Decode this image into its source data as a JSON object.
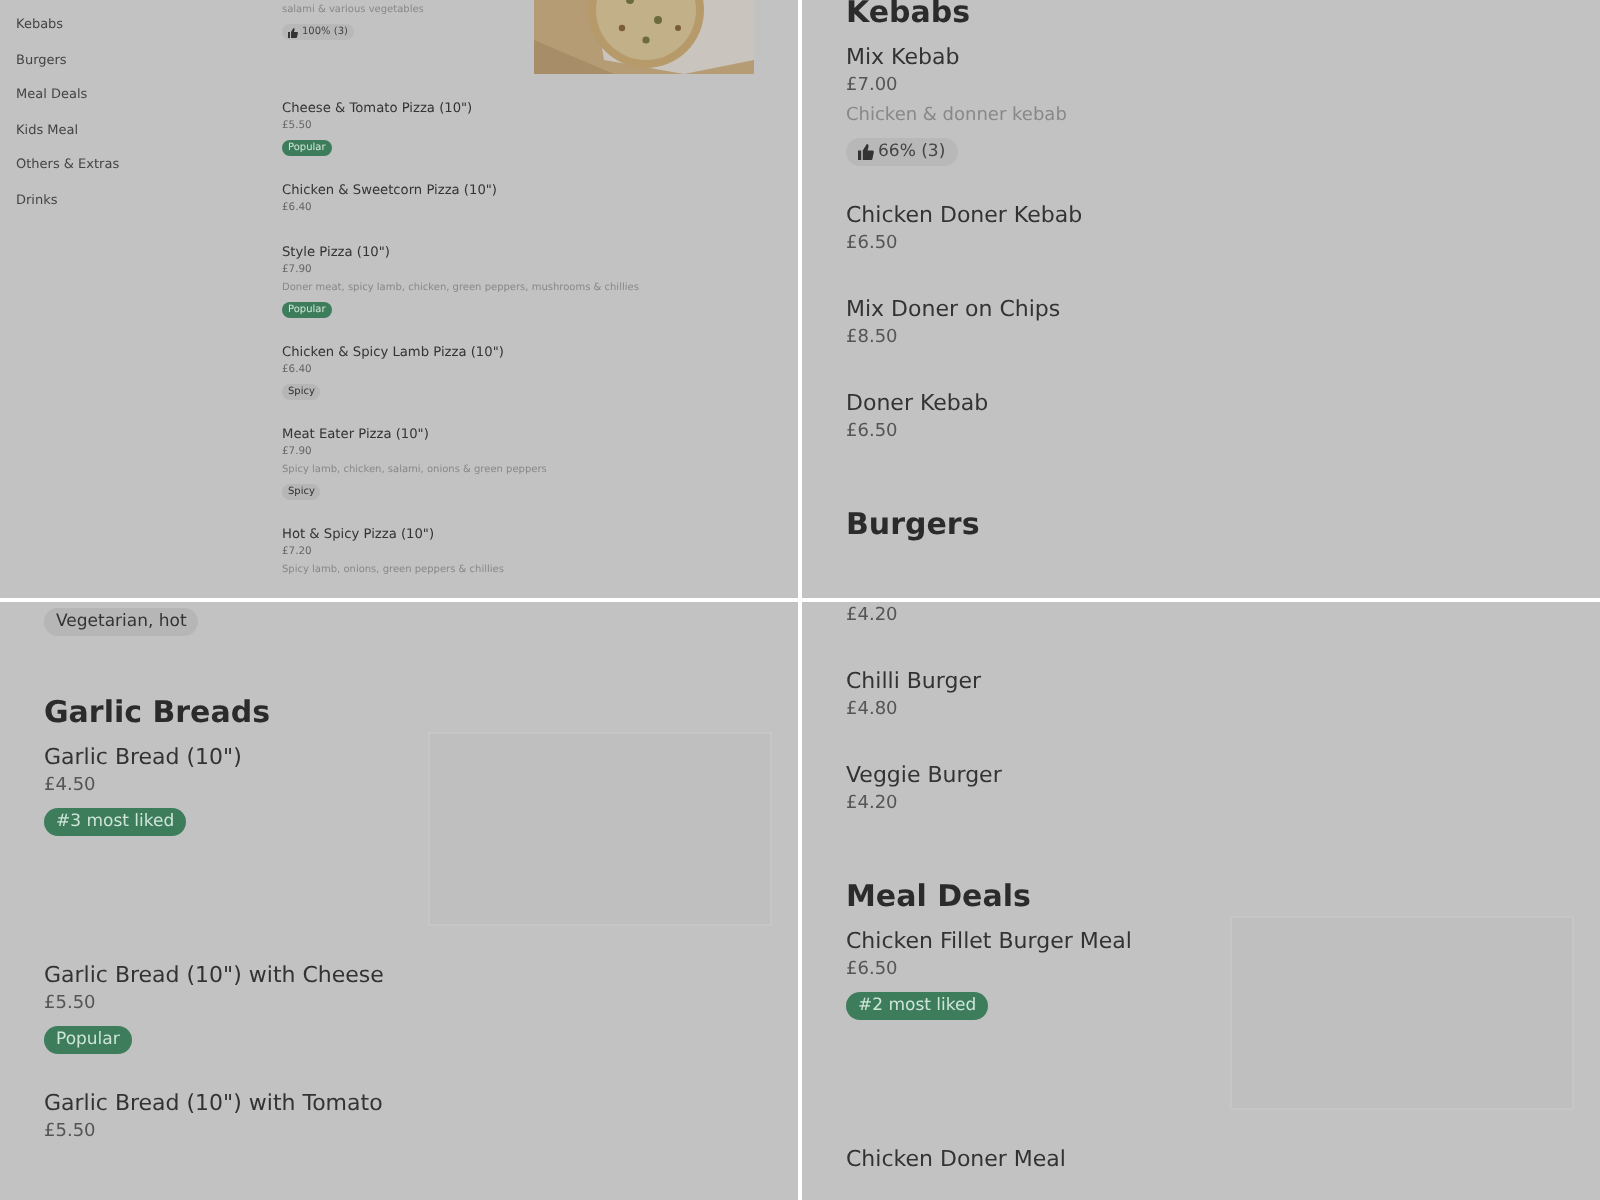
{
  "panels": [
    {
      "kind": "overview",
      "sidebar": {
        "items": [
          {
            "label": "Kebabs"
          },
          {
            "label": "Burgers"
          },
          {
            "label": "Meal Deals"
          },
          {
            "label": "Kids Meal"
          },
          {
            "label": "Others & Extras"
          },
          {
            "label": "Drinks"
          }
        ]
      },
      "blocks": [
        {
          "kind": "photo_item",
          "description": "salami & various vegetables",
          "badges": [
            {
              "kind": "rating",
              "label": "100% (3)"
            }
          ]
        },
        {
          "kind": "item",
          "name": "Cheese & Tomato Pizza (10\")",
          "price": "£5.50",
          "badges": [
            {
              "kind": "green",
              "label": "Popular"
            }
          ]
        },
        {
          "kind": "item",
          "name": "Chicken & Sweetcorn Pizza (10\")",
          "price": "£6.40"
        },
        {
          "kind": "item",
          "name": "Style Pizza (10\")",
          "price": "£7.90",
          "description": "Doner meat, spicy lamb, chicken, green peppers, mushrooms & chillies",
          "badges": [
            {
              "kind": "green",
              "label": "Popular"
            }
          ]
        },
        {
          "kind": "item",
          "name": "Chicken & Spicy Lamb Pizza (10\")",
          "price": "£6.40",
          "badges": [
            {
              "kind": "grey",
              "label": "Spicy"
            }
          ]
        },
        {
          "kind": "item",
          "name": "Meat Eater Pizza (10\")",
          "price": "£7.90",
          "description": "Spicy lamb, chicken, salami, onions & green peppers",
          "badges": [
            {
              "kind": "grey",
              "label": "Spicy"
            }
          ]
        },
        {
          "kind": "item",
          "name": "Hot & Spicy Pizza (10\")",
          "price": "£7.20",
          "description": "Spicy lamb, onions, green peppers & chillies"
        }
      ]
    },
    {
      "kind": "detail",
      "blocks": [
        {
          "kind": "heading",
          "text": "Kebabs"
        },
        {
          "kind": "item",
          "name": "Mix Kebab",
          "price": "£7.00",
          "description": "Chicken & donner kebab",
          "badges": [
            {
              "kind": "rating",
              "label": "66% (3)"
            }
          ]
        },
        {
          "kind": "item",
          "name": "Chicken Doner Kebab",
          "price": "£6.50"
        },
        {
          "kind": "item",
          "name": "Mix Doner on Chips",
          "price": "£8.50"
        },
        {
          "kind": "item",
          "name": "Doner Kebab",
          "price": "£6.50"
        },
        {
          "kind": "heading",
          "text": "Burgers"
        }
      ]
    },
    {
      "kind": "detail",
      "blocks": [
        {
          "kind": "item",
          "badges": [
            {
              "kind": "grey",
              "label": "Vegetarian, hot"
            }
          ]
        },
        {
          "kind": "heading",
          "text": "Garlic Breads"
        },
        {
          "kind": "placeholder_item",
          "name": "Garlic Bread (10\")",
          "price": "£4.50",
          "badges": [
            {
              "kind": "green",
              "label": "#3 most liked"
            }
          ]
        },
        {
          "kind": "item",
          "name": "Garlic Bread (10\") with Cheese",
          "price": "£5.50",
          "badges": [
            {
              "kind": "green",
              "label": "Popular"
            }
          ]
        },
        {
          "kind": "item",
          "name": "Garlic Bread (10\") with Tomato",
          "price": "£5.50"
        }
      ]
    },
    {
      "kind": "detail",
      "blocks": [
        {
          "kind": "item",
          "price": "£4.20"
        },
        {
          "kind": "item",
          "name": "Chilli Burger",
          "price": "£4.80"
        },
        {
          "kind": "item",
          "name": "Veggie Burger",
          "price": "£4.20"
        },
        {
          "kind": "heading",
          "text": "Meal Deals"
        },
        {
          "kind": "placeholder_item",
          "name": "Chicken Fillet Burger Meal",
          "price": "£6.50",
          "badges": [
            {
              "kind": "green",
              "label": "#2 most liked"
            }
          ]
        },
        {
          "kind": "item",
          "name": "Chicken Doner Meal"
        }
      ]
    }
  ]
}
